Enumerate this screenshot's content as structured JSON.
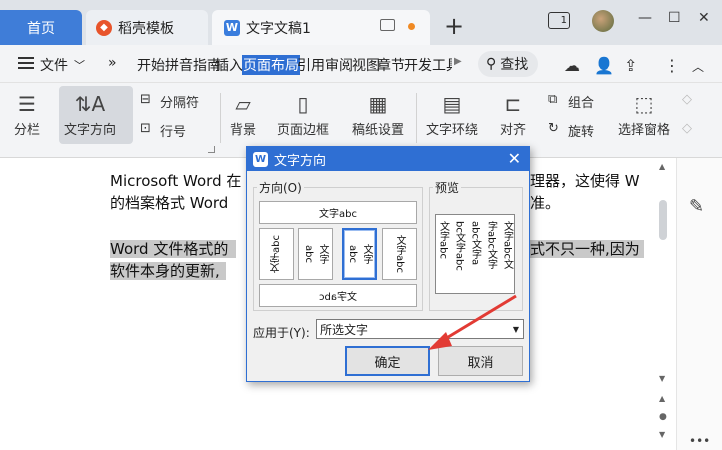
{
  "tabs": {
    "home": "首页",
    "docer": "稻壳模板",
    "doc": "文字文稿1",
    "new_tab": "+"
  },
  "window": {
    "page_count": "1"
  },
  "menu": {
    "file": "文件",
    "more": "»",
    "items": [
      "开始",
      "拼音指南",
      "插入",
      "页面布局",
      "引用",
      "审阅",
      "视图",
      "章节",
      "开发工具"
    ],
    "active": "页面布局",
    "search": "查找"
  },
  "ribbon": {
    "columns": "分栏",
    "text_direction": "文字方向",
    "separator": "分隔符",
    "line_number": "行号",
    "background": "背景",
    "page_border": "页面边框",
    "grid_paper": "稿纸设置",
    "text_wrap": "文字环绕",
    "align": "对齐",
    "group": "组合",
    "rotate": "旋转",
    "selection_pane": "选择窗格"
  },
  "document": {
    "line1a": "Microsoft Word 在",
    "line1b": "理器，这使得 W",
    "line2a": "的档案格式 Word",
    "line2b": "准。",
    "line3a": "Word 文件格式的",
    "line3b": "式不只一种,因为",
    "line4a": "软件本身的更新,"
  },
  "dialog": {
    "title": "文字方向",
    "direction_label": "方向(O)",
    "preview_label": "预览",
    "opt_horizontal": "文字abc",
    "opt_rotated": "文字abc",
    "opt_v1": "文字abc",
    "opt_v2a": "文字",
    "opt_v2b": "abc",
    "opt_v3a": "文字",
    "opt_v3b": "abc",
    "opt_v4": "文字abc",
    "preview_cols": [
      "文字abc文",
      "字abc文字",
      "abc文字a",
      "bc文字abc",
      "文字abc"
    ],
    "apply_label": "应用于(Y):",
    "apply_value": "所选文字",
    "ok": "确定",
    "cancel": "取消"
  },
  "colors": {
    "accent": "#2f6fd3",
    "annotation_arrow": "#e23b34"
  }
}
